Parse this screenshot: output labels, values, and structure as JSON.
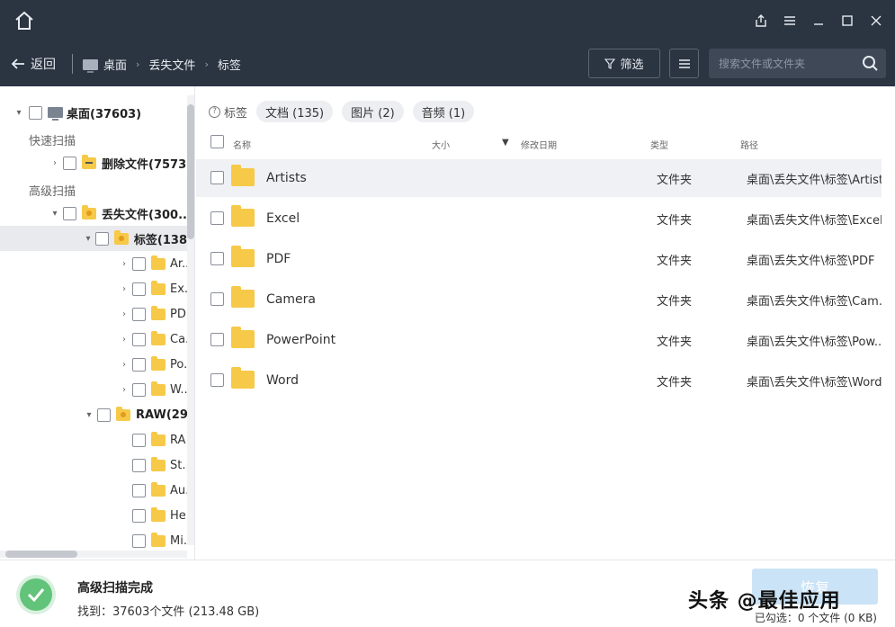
{
  "header": {
    "back_label": "返回",
    "breadcrumb": [
      "桌面",
      "丢失文件",
      "标签"
    ],
    "filter_label": "筛选",
    "search_placeholder": "搜索文件或文件夹"
  },
  "sidebar": {
    "root": "桌面(37603)",
    "quick_scan_label": "快速扫描",
    "deleted_files": "删除文件(7573",
    "advanced_scan_label": "高级扫描",
    "lost_files": "丢失文件(300...",
    "tags_folder": "标签(138",
    "tag_children": [
      "Ar...",
      "Ex...",
      "PD",
      "Ca...",
      "Po...",
      "W..."
    ],
    "raw_folder": "RAW(29...",
    "raw_children": [
      "RA",
      "St...",
      "Au...",
      "He",
      "Mi..."
    ]
  },
  "tabs": {
    "label": "标签",
    "items": [
      "文档 (135)",
      "图片 (2)",
      "音频 (1)"
    ]
  },
  "columns": {
    "name": "名称",
    "size": "大小",
    "modified": "修改日期",
    "type": "类型",
    "path": "路径"
  },
  "files": [
    {
      "name": "Artists",
      "type": "文件夹",
      "path": "桌面\\丢失文件\\标签\\Artists"
    },
    {
      "name": "Excel",
      "type": "文件夹",
      "path": "桌面\\丢失文件\\标签\\Excel"
    },
    {
      "name": "PDF",
      "type": "文件夹",
      "path": "桌面\\丢失文件\\标签\\PDF"
    },
    {
      "name": "Camera",
      "type": "文件夹",
      "path": "桌面\\丢失文件\\标签\\Cam..."
    },
    {
      "name": "PowerPoint",
      "type": "文件夹",
      "path": "桌面\\丢失文件\\标签\\Pow..."
    },
    {
      "name": "Word",
      "type": "文件夹",
      "path": "桌面\\丢失文件\\标签\\Word"
    }
  ],
  "footer": {
    "status_title": "高级扫描完成",
    "status_sub": "找到：37603个文件 (213.48 GB)",
    "recover_label": "恢复",
    "selected_info": "已勾选：0 个文件 (0 KB)",
    "watermark": "头条 @最佳应用"
  },
  "colors": {
    "titlebar": "#2b3441",
    "folder": "#f7c948",
    "success": "#62c37a",
    "recover_disabled": "#cbe3f6"
  }
}
